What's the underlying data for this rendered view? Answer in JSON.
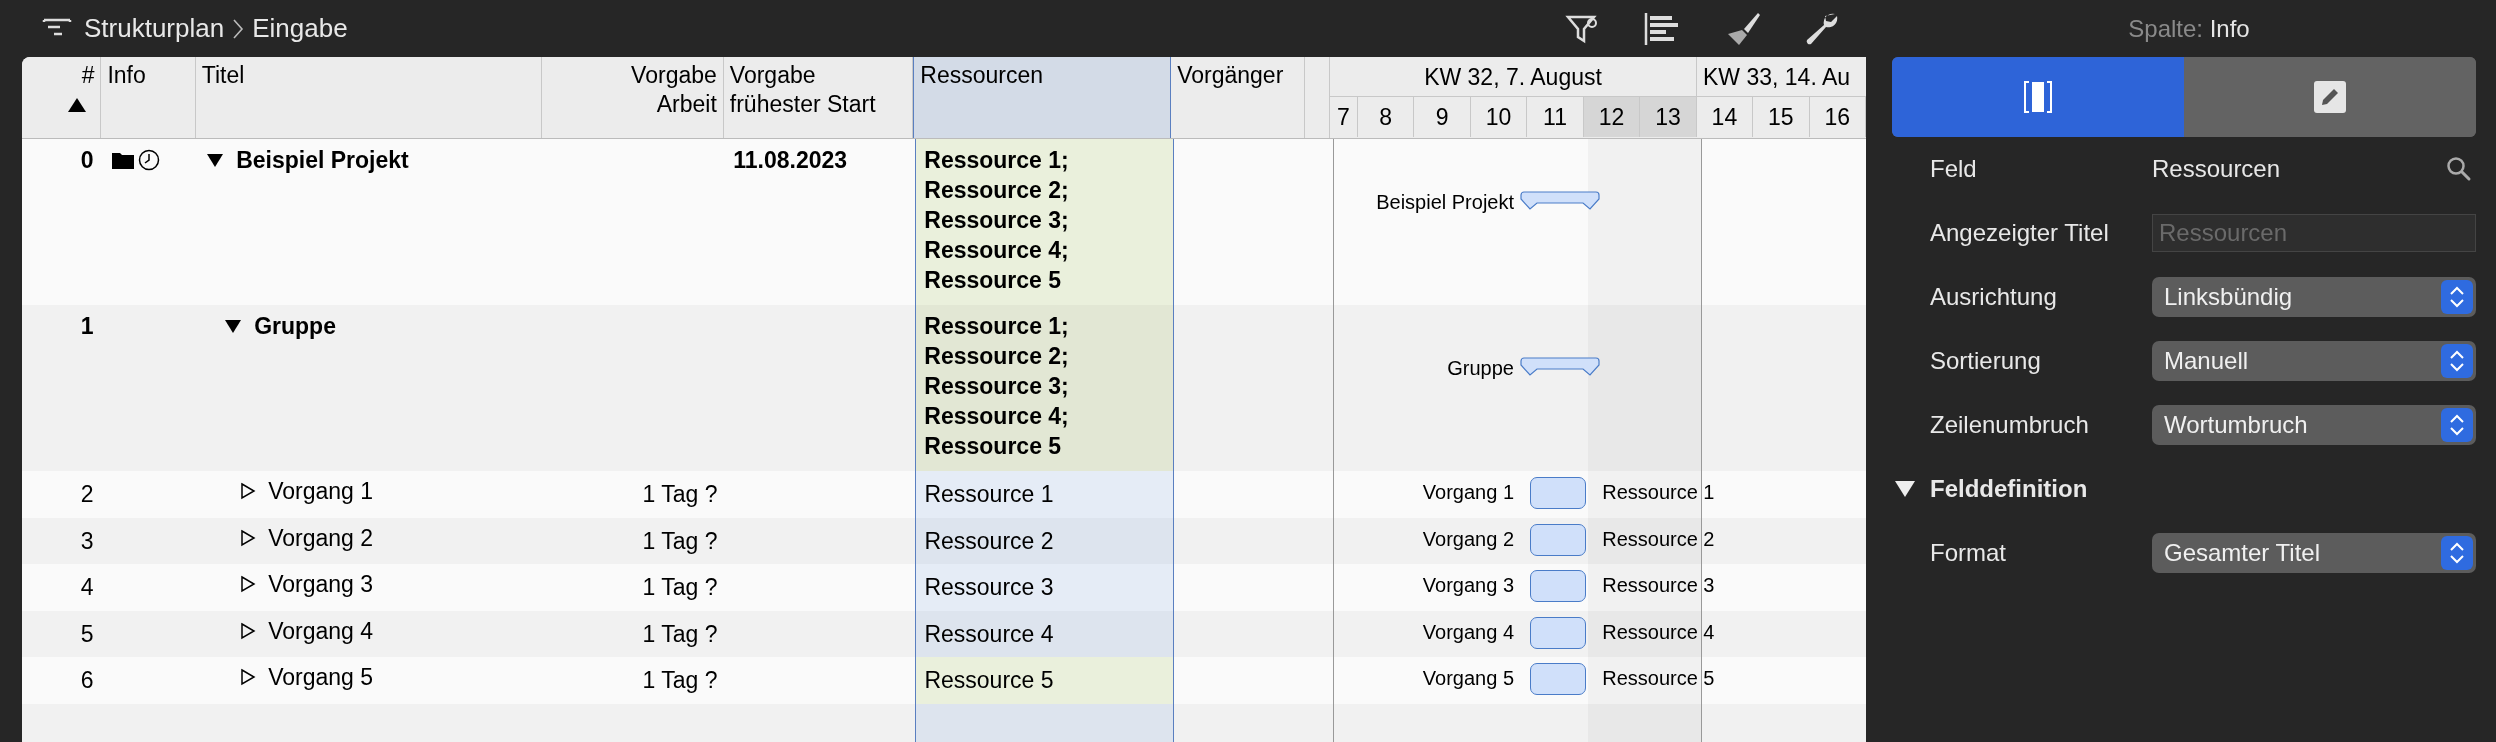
{
  "breadcrumb": {
    "items": [
      "Strukturplan",
      "Eingabe"
    ]
  },
  "table": {
    "columns": [
      {
        "label": "#",
        "sorted": true,
        "selected": false
      },
      {
        "label": "Info",
        "sorted": false,
        "selected": false
      },
      {
        "label": "Titel",
        "sorted": false,
        "selected": false
      },
      {
        "label": "Vorgabe Arbeit",
        "sorted": false,
        "selected": false
      },
      {
        "label": "Vorgabe frühester Start",
        "sorted": false,
        "selected": false
      },
      {
        "label": "Ressourcen",
        "sorted": false,
        "selected": true
      },
      {
        "label": "Vorgänger",
        "sorted": false,
        "selected": false
      }
    ],
    "rows": [
      {
        "kind": "project",
        "num": "0",
        "expanded": true,
        "title": "Beispiel Projekt",
        "work": "",
        "start": "11.08.2023",
        "resources": "Ressource 1; Ressource 2; Ressource 3; Ressource 4; Ressource 5",
        "highlighted": true,
        "gantt_label": "Beispiel Projekt",
        "gantt_resource": ""
      },
      {
        "kind": "group",
        "num": "1",
        "expanded": true,
        "title": "Gruppe",
        "work": "",
        "start": "",
        "resources": "Ressource 1; Ressource 2; Ressource 3; Ressource 4; Ressource 5",
        "highlighted": true,
        "gantt_label": "Gruppe",
        "gantt_resource": ""
      },
      {
        "kind": "task",
        "num": "2",
        "expanded": false,
        "title": "Vorgang 1",
        "work": "1 Tag ?",
        "start": "",
        "resources": "Ressource 1",
        "highlighted": false,
        "gantt_label": "Vorgang 1",
        "gantt_resource": "Ressource 1"
      },
      {
        "kind": "task",
        "num": "3",
        "expanded": false,
        "title": "Vorgang 2",
        "work": "1 Tag ?",
        "start": "",
        "resources": "Ressource 2",
        "highlighted": false,
        "gantt_label": "Vorgang 2",
        "gantt_resource": "Ressource 2"
      },
      {
        "kind": "task",
        "num": "4",
        "expanded": false,
        "title": "Vorgang 3",
        "work": "1 Tag ?",
        "start": "",
        "resources": "Ressource 3",
        "highlighted": false,
        "gantt_label": "Vorgang 3",
        "gantt_resource": "Ressource 3"
      },
      {
        "kind": "task",
        "num": "5",
        "expanded": false,
        "title": "Vorgang 4",
        "work": "1 Tag ?",
        "start": "",
        "resources": "Ressource 4",
        "highlighted": false,
        "gantt_label": "Vorgang 4",
        "gantt_resource": "Ressource 4"
      },
      {
        "kind": "task",
        "num": "6",
        "expanded": false,
        "title": "Vorgang 5",
        "work": "1 Tag ?",
        "start": "",
        "resources": "Ressource 5",
        "highlighted": true,
        "gantt_label": "Vorgang 5",
        "gantt_resource": "Ressource 5"
      }
    ]
  },
  "timeline": {
    "weeks": [
      {
        "label": "KW 32, 7. August"
      },
      {
        "label": "KW 33, 14. Au"
      }
    ],
    "days": [
      {
        "label": "7",
        "weekend": false
      },
      {
        "label": "8",
        "weekend": false
      },
      {
        "label": "9",
        "weekend": false
      },
      {
        "label": "10",
        "weekend": false
      },
      {
        "label": "11",
        "weekend": false
      },
      {
        "label": "12",
        "weekend": true
      },
      {
        "label": "13",
        "weekend": true
      },
      {
        "label": "14",
        "weekend": false
      },
      {
        "label": "15",
        "weekend": false
      },
      {
        "label": "16",
        "weekend": false
      }
    ]
  },
  "inspector": {
    "title_label": "Spalte:",
    "title_value": "Info",
    "segments": [
      {
        "kind": "column",
        "selected": true
      },
      {
        "kind": "edit",
        "selected": false
      }
    ],
    "fields": [
      {
        "kind": "text",
        "label": "Feld",
        "value": "Ressourcen"
      },
      {
        "kind": "input",
        "label": "Angezeigter Titel",
        "placeholder": "Ressourcen"
      },
      {
        "kind": "popup",
        "label": "Ausrichtung",
        "value": "Linksbündig"
      },
      {
        "kind": "popup",
        "label": "Sortierung",
        "value": "Manuell"
      },
      {
        "kind": "popup",
        "label": "Zeilenumbruch",
        "value": "Wortumbruch"
      }
    ],
    "section": {
      "title": "Felddefinition",
      "expanded": true,
      "fields": [
        {
          "kind": "popup",
          "label": "Format",
          "value": "Gesamter Titel"
        }
      ]
    }
  }
}
